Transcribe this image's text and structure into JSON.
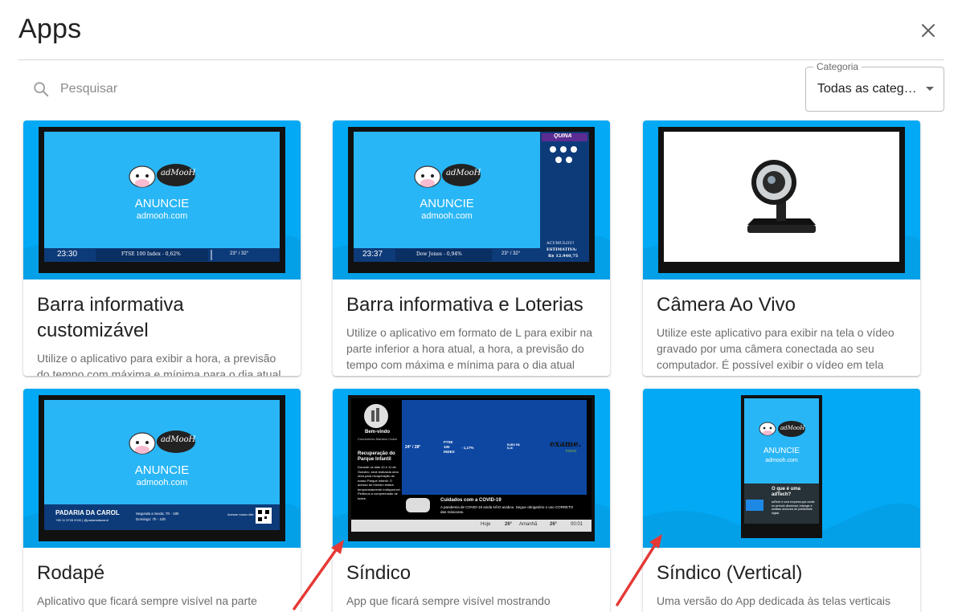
{
  "dialog": {
    "title": "Apps",
    "close_icon": "close-icon"
  },
  "search": {
    "placeholder": "Pesquisar",
    "icon": "search-icon"
  },
  "category": {
    "label": "Categoria",
    "value": "Todas as categorias"
  },
  "colors": {
    "thumb_blue": "#03a9f4",
    "screen_blue": "#29b6f6",
    "bar_navy": "#0d3b7a",
    "arrow_red": "#e53935"
  },
  "cards": [
    {
      "title_line1": "Barra informativa",
      "title_line2": "customizável",
      "desc": "Utilize o aplicativo para exibir a hora, a previsão do tempo com máxima e mínima para o dia atual",
      "screen": {
        "brand": "adMooH",
        "anuncie": "ANUNCIE",
        "site": "admooh.com",
        "time": "23:30",
        "ticker": "FTSE 100 Index - 0,62%",
        "weather": "23° / 32°"
      }
    },
    {
      "title_line1": "Barra informativa e Loterias",
      "desc": "Utilize o aplicativo em formato de L para exibir na parte inferior a hora atual, a hora, a previsão do tempo com máxima e mínima para o dia atual",
      "screen": {
        "brand": "adMooH",
        "anuncie": "ANUNCIE",
        "site": "admooh.com",
        "time": "23:37",
        "ticker": "Dow Jones - 0,94%",
        "weather": "23° / 32°",
        "lottery": "QUINA",
        "acumulou": "ACUMULOU!",
        "estimativa": "ESTIMATIVA:",
        "valor": "R$ 12.940,75"
      }
    },
    {
      "title_line1": "Câmera Ao Vivo",
      "desc": "Utilize este aplicativo para exibir na tela o vídeo gravado por uma câmera conectada ao seu computador. É possível exibir o vídeo em tela"
    },
    {
      "title_line1": "Rodapé",
      "desc": "Aplicativo que ficará sempre visível na parte",
      "screen": {
        "brand": "adMooH",
        "anuncie": "ANUNCIE",
        "site": "admooh.com",
        "shop": "PADARIA DA CAROL",
        "phone": "+55 11 3728 2040 | @padariadacarol",
        "hours1": "Segunda a Sexta: 7h - 18h",
        "hours2": "Domingo: 7h - 10h",
        "qr_label": "Acesse nosso site:"
      }
    },
    {
      "title_line1": "Síndico",
      "desc": "App que ficará sempre visível mostrando",
      "screen": {
        "welcome": "Bem-vindo",
        "condo": "Condomínio Mariano Costa",
        "news_title": "Recuperação do Parque Infantil",
        "news_body": "Durante os dias 10 e 11 de Outubro, será realizada uma obra para recuperação do nosso Parque Infantil. O acesso ao mesmo estará temporariamente indisponível. Pedimos a compreensão de todos.",
        "weather": "24° / 28°",
        "ftse": "FTSE 100 INDEX",
        "ftse_val": "- 1,17%",
        "euro": "EURO R$ 6,16",
        "exame": "exame.",
        "invest": "invest",
        "covid_title": "Cuidados com a COVID-19",
        "covid_body": "A pandemia de COVID-19 ainda NÃO acabou. Segue obrigatório o uso CORRETO das máscaras.",
        "hoje": "Hoje",
        "hoje_temp": "26°",
        "amanha": "Amanhã",
        "amanha_temp": "26°",
        "clock": "00:01"
      }
    },
    {
      "title_line1": "Síndico (Vertical)",
      "desc": "Uma versão do App dedicada às telas verticais",
      "screen": {
        "brand": "adMooH",
        "anuncie": "ANUNCIE",
        "site": "admooh.com",
        "q": "O que é uma adTech?",
        "a": "adTech é uma empresa que oscila no período direcional, entregar e analisar anúncios de publicidade digital."
      }
    }
  ]
}
